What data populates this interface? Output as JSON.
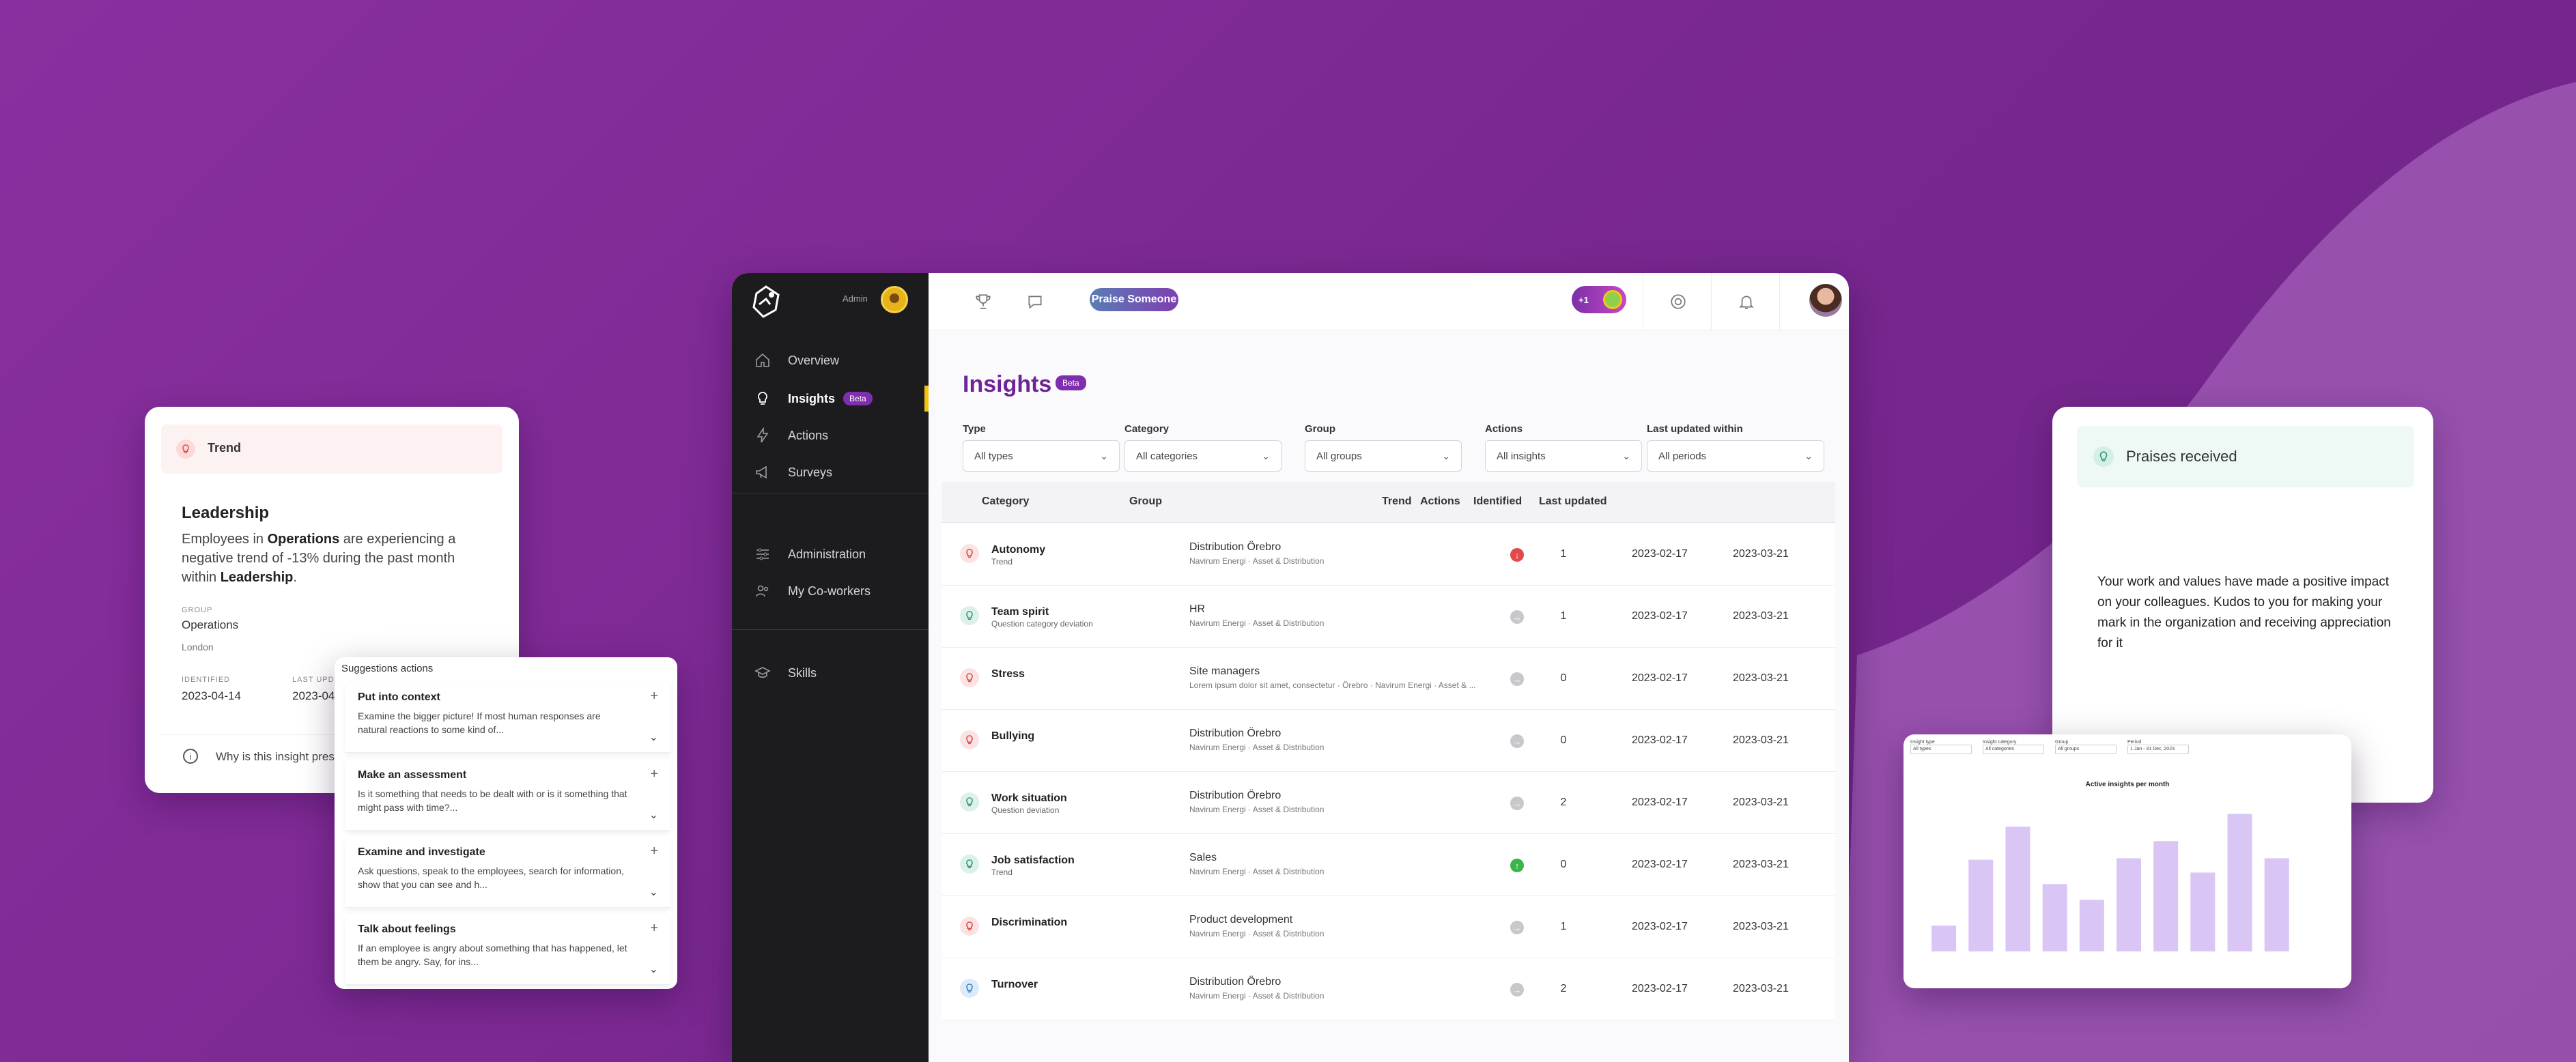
{
  "colors": {
    "brand_purple": "#7a2b99",
    "accent_purple": "#6e2399",
    "sidebar_bg": "#1c1c1f",
    "active_yellow": "#f1c40f",
    "negative_red": "#e04a4a",
    "positive_green": "#3bb54a",
    "neutral_grey": "#c8c8cc",
    "bar_lavender": "#d9c6f5"
  },
  "sidebar": {
    "admin_label": "Admin",
    "items": [
      {
        "label": "Overview",
        "icon": "home-icon"
      },
      {
        "label": "Insights",
        "icon": "lightbulb-icon",
        "badge": "Beta",
        "active": true
      },
      {
        "label": "Actions",
        "icon": "lightning-icon"
      },
      {
        "label": "Surveys",
        "icon": "megaphone-icon"
      },
      {
        "label": "Administration",
        "icon": "sliders-icon"
      },
      {
        "label": "My Co-workers",
        "icon": "people-icon"
      },
      {
        "label": "Skills",
        "icon": "graduation-cap-icon"
      }
    ]
  },
  "topbar": {
    "praise_button": "Praise Someone",
    "points_label": "+1"
  },
  "main": {
    "title": "Insights",
    "title_badge": "Beta",
    "filters": [
      {
        "label": "Type",
        "value": "All types"
      },
      {
        "label": "Category",
        "value": "All categories"
      },
      {
        "label": "Group",
        "value": "All groups"
      },
      {
        "label": "Actions",
        "value": "All insights"
      },
      {
        "label": "Last updated within",
        "value": "All periods"
      }
    ],
    "columns": [
      "Category",
      "Group",
      "Trend",
      "Actions",
      "Identified",
      "Last updated"
    ],
    "rows": [
      {
        "category": "Autonomy",
        "sub": "Trend",
        "group": "Distribution Örebro",
        "group_sub": "Navirum Energi  ·  Asset & Distribution",
        "trend": "negative",
        "actions": "1",
        "identified": "2023-02-17",
        "updated": "2023-03-21",
        "type": "negative"
      },
      {
        "category": "Team spirit",
        "sub": "Question category deviation",
        "group": "HR",
        "group_sub": "Navirum Energi  ·  Asset & Distribution",
        "trend": "neutral",
        "actions": "1",
        "identified": "2023-02-17",
        "updated": "2023-03-21",
        "type": "positive"
      },
      {
        "category": "Stress",
        "sub": "",
        "group": "Site managers",
        "group_sub": "Lorem ipsum dolor sit amet, consectetur  ·  Örebro  ·  Navirum Energi  ·  Asset & ...",
        "trend": "neutral",
        "actions": "0",
        "identified": "2023-02-17",
        "updated": "2023-03-21",
        "type": "negative"
      },
      {
        "category": "Bullying",
        "sub": "",
        "group": "Distribution Örebro",
        "group_sub": "Navirum Energi  ·  Asset & Distribution",
        "trend": "neutral",
        "actions": "0",
        "identified": "2023-02-17",
        "updated": "2023-03-21",
        "type": "negative"
      },
      {
        "category": "Work situation",
        "sub": "Question deviation",
        "group": "Distribution Örebro",
        "group_sub": "Navirum Energi  ·  Asset & Distribution",
        "trend": "neutral",
        "actions": "2",
        "identified": "2023-02-17",
        "updated": "2023-03-21",
        "type": "positive"
      },
      {
        "category": "Job satisfaction",
        "sub": "Trend",
        "group": "Sales",
        "group_sub": "Navirum Energi  ·  Asset & Distribution",
        "trend": "positive",
        "actions": "0",
        "identified": "2023-02-17",
        "updated": "2023-03-21",
        "type": "positive"
      },
      {
        "category": "Discrimination",
        "sub": "",
        "group": "Product development",
        "group_sub": "Navirum Energi  ·  Asset & Distribution",
        "trend": "neutral",
        "actions": "1",
        "identified": "2023-02-17",
        "updated": "2023-03-21",
        "type": "negative"
      },
      {
        "category": "Turnover",
        "sub": "",
        "group": "Distribution Örebro",
        "group_sub": "Navirum Energi  ·  Asset & Distribution",
        "trend": "neutral",
        "actions": "2",
        "identified": "2023-02-17",
        "updated": "2023-03-21",
        "type": "info"
      }
    ]
  },
  "trend_card": {
    "header": "Trend",
    "title": "Leadership",
    "body_pre": "Employees in ",
    "body_bold1": "Operations",
    "body_mid": " are experiencing a negative trend of -13% during the past month within ",
    "body_bold2": "Leadership",
    "body_post": ".",
    "group_key": "GROUP",
    "group_value": "Operations",
    "group_sub": "London",
    "identified_key": "IDENTIFIED",
    "identified_value": "2023-04-14",
    "updated_key": "LAST UPDA",
    "updated_value": "2023-04",
    "footer": "Why is this insight prese"
  },
  "suggestions": {
    "title": "Suggestions actions",
    "items": [
      {
        "title": "Put into context",
        "desc": "Examine the bigger picture! If most human responses are natural reactions to some kind of..."
      },
      {
        "title": "Make an assessment",
        "desc": "Is it something that needs to be dealt with or is it something that might pass with time?..."
      },
      {
        "title": "Examine and investigate",
        "desc": "Ask questions, speak to the employees, search for information, show that you can see and h..."
      },
      {
        "title": "Talk about feelings",
        "desc": "If an employee is angry about something that has happened, let them be angry. Say, for ins..."
      }
    ]
  },
  "praise_card": {
    "header": "Praises received",
    "body": "Your work and values have made a positive impact on your colleagues. Kudos to you for making your mark in the organization and receiving appreciation for it"
  },
  "chart_card": {
    "filters": [
      {
        "label": "Insight type",
        "value": "All types"
      },
      {
        "label": "Insight category",
        "value": "All categories"
      },
      {
        "label": "Group",
        "value": "All groups"
      },
      {
        "label": "Period",
        "value": "1 Jan - 31 Dec, 2023"
      }
    ]
  },
  "chart_data": {
    "type": "bar",
    "title": "Active insights per month",
    "xlabel": "",
    "ylabel": "",
    "categories": [
      "",
      "",
      "",
      "",
      "",
      "",
      "",
      "",
      "",
      "",
      ""
    ],
    "values": [
      18,
      64,
      87,
      47,
      36,
      65,
      77,
      55,
      96,
      65,
      0
    ],
    "ylim": [
      0,
      100
    ],
    "grid": false
  }
}
